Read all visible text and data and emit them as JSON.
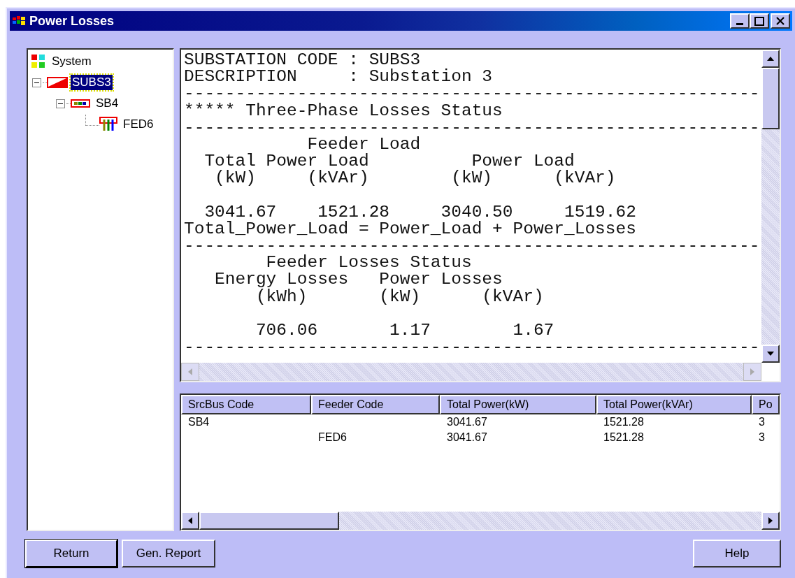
{
  "window": {
    "title": "Power Losses"
  },
  "tree": [
    {
      "label": "System",
      "kind": "system",
      "selected": false,
      "children": [
        {
          "label": "SUBS3",
          "kind": "substation",
          "selected": true,
          "expanded": true,
          "children": [
            {
              "label": "SB4",
              "kind": "bus",
              "selected": false,
              "expanded": true,
              "children": [
                {
                  "label": "FED6",
                  "kind": "feeder",
                  "selected": false
                }
              ]
            }
          ]
        }
      ]
    }
  ],
  "report": {
    "blocks": [
      {
        "lines": [
          "SUBSTATION CODE : SUBS3",
          "DESCRIPTION     : Substation 3",
          "--------------------------------------------------------",
          "***** Three-Phase Losses Status",
          "--------------------------------------------------------",
          "            Feeder Load",
          "  Total Power Load          Power Load",
          "   (kW)     (kVAr)        (kW)      (kVAr)"
        ]
      },
      {
        "lines": [
          "  3041.67    1521.28     3040.50     1519.62",
          "Total_Power_Load = Power_Load + Power_Losses",
          "--------------------------------------------------------",
          "        Feeder Losses Status",
          "   Energy Losses   Power Losses",
          "       (kWh)       (kW)      (kVAr)"
        ]
      },
      {
        "lines": [
          "       706.06       1.17        1.67",
          "--------------------------------------------------------"
        ]
      }
    ]
  },
  "table": {
    "columns": [
      "SrcBus Code",
      "Feeder Code",
      "Total Power(kW)",
      "Total Power(kVAr)",
      "Po"
    ],
    "rows": [
      [
        "SB4",
        "",
        "3041.67",
        "1521.28",
        "3"
      ],
      [
        "",
        "FED6",
        "3041.67",
        "1521.28",
        "3"
      ]
    ]
  },
  "buttons": [
    {
      "label": "Return",
      "kind": "default"
    },
    {
      "label": "Gen. Report",
      "kind": "normal"
    },
    {
      "label": "Help",
      "kind": "right"
    }
  ]
}
